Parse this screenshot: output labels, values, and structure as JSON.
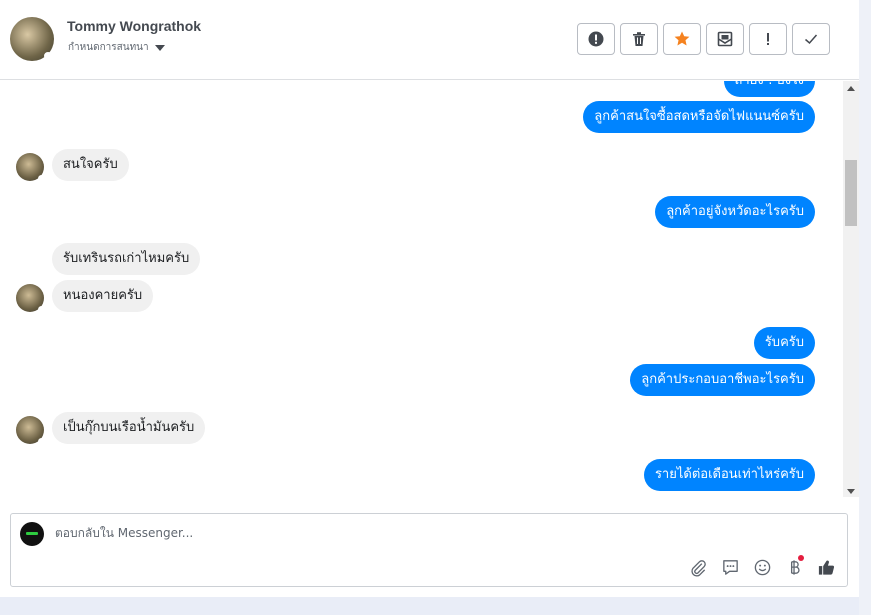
{
  "header": {
    "contact_name": "Tommy Wongrathok",
    "status_label": "กำหนดการสนทนา"
  },
  "actions": [
    {
      "name": "spam-button",
      "icon": "alert-circle-icon"
    },
    {
      "name": "delete-button",
      "icon": "trash-icon"
    },
    {
      "name": "star-button",
      "icon": "star-icon",
      "color": "#f5821f"
    },
    {
      "name": "mark-unread-button",
      "icon": "envelope-icon"
    },
    {
      "name": "follow-up-button",
      "icon": "exclamation-icon"
    },
    {
      "name": "done-button",
      "icon": "check-icon"
    }
  ],
  "messages": [
    {
      "id": "m1",
      "side": "out",
      "text": "ถ้ายัง ! ยังไง"
    },
    {
      "id": "m2",
      "side": "out",
      "text": "ลูกค้าสนใจซื้อสดหรือจัดไฟแนนซ์ครับ"
    },
    {
      "id": "m3",
      "side": "in",
      "text": "สนใจครับ"
    },
    {
      "id": "m4",
      "side": "out",
      "text": "ลูกค้าอยู่จังหวัดอะไรครับ"
    },
    {
      "id": "m5",
      "side": "in",
      "text": "รับเทรินรถเก่าไหมครับ"
    },
    {
      "id": "m6",
      "side": "in",
      "text": "หนองคายครับ"
    },
    {
      "id": "m7",
      "side": "out",
      "text": "รับครับ"
    },
    {
      "id": "m8",
      "side": "out",
      "text": "ลูกค้าประกอบอาชีพอะไรครับ"
    },
    {
      "id": "m9",
      "side": "in",
      "text": "เป็นกุ๊กบนเรือน้ำมันครับ"
    },
    {
      "id": "m10",
      "side": "out",
      "text": "รายได้ต่อเดือนเท่าไหร่ครับ"
    }
  ],
  "composer": {
    "placeholder": "ตอบกลับใน Messenger...",
    "tools": [
      "paperclip-icon",
      "quick-reply-icon",
      "emoji-icon",
      "baht-payment-icon",
      "like-icon"
    ]
  },
  "colors": {
    "outgoing_bubble": "#0084ff",
    "incoming_bubble": "#f0f0f0",
    "star": "#f5821f",
    "notification_dot": "#e41e3f"
  }
}
